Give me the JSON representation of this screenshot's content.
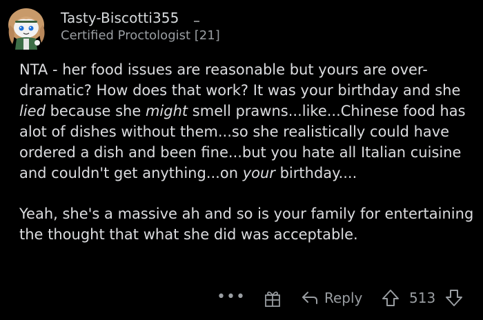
{
  "comment": {
    "username": "Tasty-Biscotti355",
    "flair": "Certified Proctologist [21]",
    "body": {
      "p1": [
        "NTA  - her food issues are reasonable but yours are over-dramatic? How does that work? It was your birthday and she ",
        "lied",
        " because she ",
        "might",
        " smell prawns...like...Chinese food has alot of dishes without them...so she realistically could have ordered a dish and been fine...but you hate all Italian cuisine and couldn't get anything...on ",
        "your",
        " birthday...."
      ],
      "p2": "Yeah, she's a massive ah and so is your family for entertaining the thought that what she did was acceptable."
    },
    "actions": {
      "more_label": "•••",
      "reply_label": "Reply",
      "score": "513"
    }
  },
  "icons": {
    "avatar": "snoo-avatar-icon",
    "award": "gift-award-icon",
    "reply": "reply-arrow-icon",
    "upvote": "upvote-arrow-icon",
    "downvote": "downvote-arrow-icon"
  },
  "colors": {
    "background": "#000000",
    "text": "#dcdde0",
    "muted": "#9a9ea2"
  }
}
